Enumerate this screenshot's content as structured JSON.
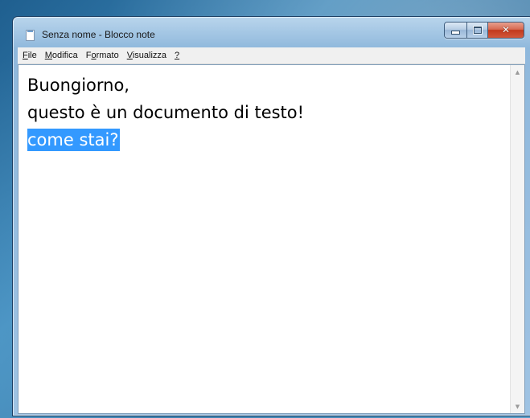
{
  "window": {
    "title": "Senza nome - Blocco note",
    "close_glyph": "✕"
  },
  "menu": {
    "items": [
      {
        "key": "F",
        "rest": "ile"
      },
      {
        "key": "M",
        "rest": "odifica"
      },
      {
        "pre": "F",
        "key": "o",
        "rest": "rmato"
      },
      {
        "key": "V",
        "rest": "isualizza"
      },
      {
        "key": "?",
        "rest": ""
      }
    ]
  },
  "document": {
    "lines": [
      "Buongiorno,",
      "questo è un documento di testo!"
    ],
    "selected_line": "come stai?"
  },
  "colors": {
    "selection": "#3399ff",
    "close_button": "#c2391c"
  },
  "icons": {
    "app": "notepad-icon",
    "minimize": "minimize-icon",
    "maximize": "maximize-icon",
    "close": "close-icon",
    "scroll_up": "scroll-up-arrow-icon",
    "scroll_down": "scroll-down-arrow-icon"
  }
}
